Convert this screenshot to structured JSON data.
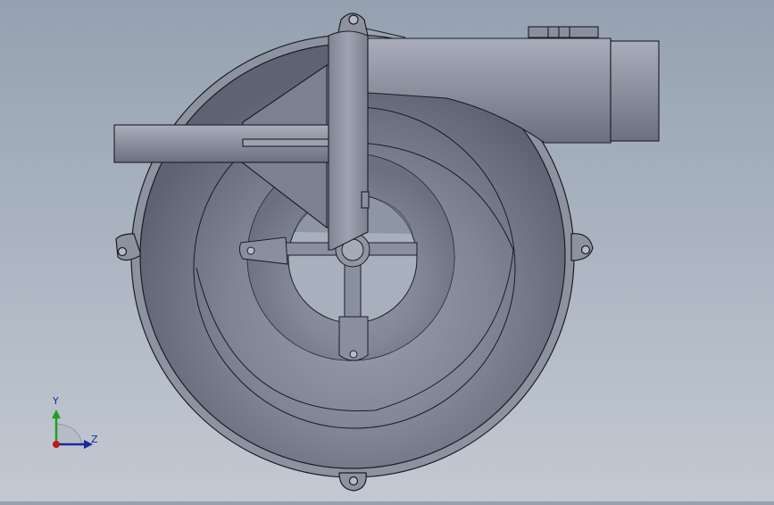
{
  "viewport": {
    "background_top": "#95a1b0",
    "background_bottom": "#c3c9d2",
    "model": "centrifugal-blower-volute"
  },
  "triad": {
    "y_label": "Y",
    "z_label": "Z",
    "y_color": "#1fa01f",
    "z_color": "#1a2a9a",
    "x_color": "#c01818"
  },
  "colors": {
    "body": "#868b9a",
    "body_light": "#a6aab8",
    "body_dark": "#5f6474",
    "edge": "#1c1c22"
  }
}
